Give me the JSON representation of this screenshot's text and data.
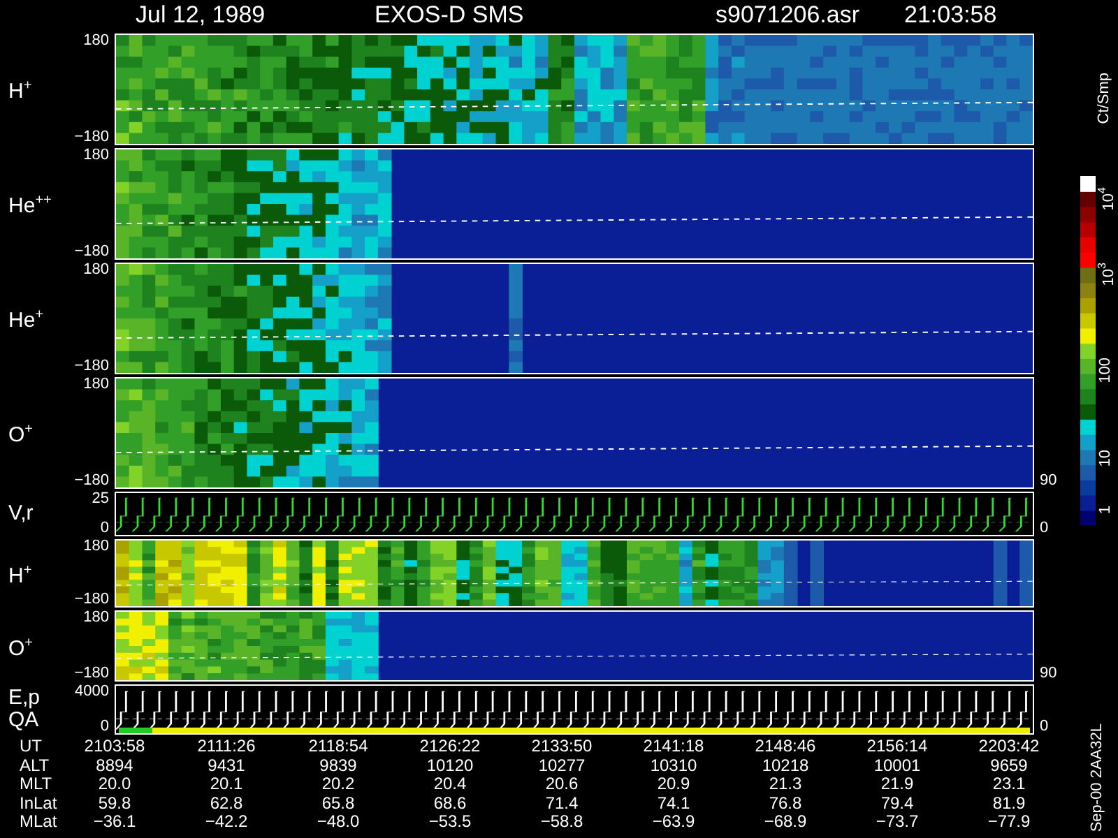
{
  "header": {
    "date": "Jul 12, 1989",
    "instrument": "EXOS-D SMS",
    "file": "s9071206.asr",
    "time": "21:03:58"
  },
  "panels": [
    {
      "kind": "spectrogram",
      "label": "H$^{+}$",
      "top_tick": "180",
      "bottom_tick": "−180"
    },
    {
      "kind": "spectrogram",
      "label": "He$^{++}$",
      "top_tick": "180",
      "bottom_tick": "−180"
    },
    {
      "kind": "spectrogram",
      "label": "He$^{+}$",
      "top_tick": "180",
      "bottom_tick": "−180"
    },
    {
      "kind": "spectrogram",
      "label": "O$^{+}$",
      "top_tick": "180",
      "bottom_tick": "−180",
      "right_ticks": [
        "90"
      ]
    },
    {
      "kind": "line",
      "label": "V,r",
      "top_tick": "25",
      "bottom_tick": "0",
      "right_ticks": [
        "0"
      ]
    },
    {
      "kind": "spectrogram",
      "label": "H$^{+}$",
      "top_tick": "180",
      "bottom_tick": "−180"
    },
    {
      "kind": "spectrogram",
      "label": "O$^{+}$",
      "top_tick": "180",
      "bottom_tick": "−180",
      "right_ticks": [
        "90"
      ]
    },
    {
      "kind": "line",
      "label": "E,p",
      "label2": "QA",
      "top_tick": "4000",
      "bottom_tick": "0",
      "right_ticks": [
        "0"
      ]
    }
  ],
  "colorbar": {
    "unit": "Ct/Smp",
    "ticks": [
      "10$^{4}$",
      "10$^{3}$",
      "100",
      "10",
      "1"
    ]
  },
  "table": [
    {
      "label": "UT",
      "values": [
        "2103:58",
        "2111:26",
        "2118:54",
        "2126:22",
        "2133:50",
        "2141:18",
        "2148:46",
        "2156:14",
        "2203:42"
      ]
    },
    {
      "label": "ALT",
      "values": [
        "8894",
        "9431",
        "9839",
        "10120",
        "10277",
        "10310",
        "10218",
        "10001",
        "9659"
      ]
    },
    {
      "label": "MLT",
      "values": [
        "20.0",
        "20.1",
        "20.2",
        "20.4",
        "20.6",
        "20.9",
        "21.3",
        "21.9",
        "23.1"
      ]
    },
    {
      "label": "InLat",
      "values": [
        "59.8",
        "62.8",
        "65.8",
        "68.6",
        "71.4",
        "74.1",
        "76.8",
        "79.4",
        "81.9"
      ]
    },
    {
      "label": "MLat",
      "values": [
        "−36.1",
        "−42.2",
        "−48.0",
        "−53.5",
        "−58.8",
        "−63.9",
        "−68.9",
        "−73.7",
        "−77.9"
      ]
    }
  ],
  "stamp": "Sep-00 2AA32L"
}
